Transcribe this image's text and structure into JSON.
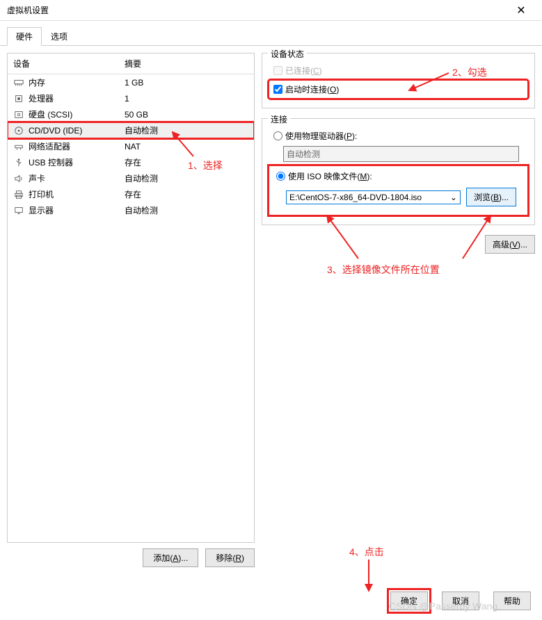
{
  "window": {
    "title": "虚拟机设置"
  },
  "tabs": {
    "hardware": "硬件",
    "options": "选项"
  },
  "deviceTable": {
    "headers": {
      "device": "设备",
      "summary": "摘要"
    },
    "rows": [
      {
        "name": "内存",
        "summary": "1 GB"
      },
      {
        "name": "处理器",
        "summary": "1"
      },
      {
        "name": "硬盘 (SCSI)",
        "summary": "50 GB"
      },
      {
        "name": "CD/DVD (IDE)",
        "summary": "自动检测"
      },
      {
        "name": "网络适配器",
        "summary": "NAT"
      },
      {
        "name": "USB 控制器",
        "summary": "存在"
      },
      {
        "name": "声卡",
        "summary": "自动检测"
      },
      {
        "name": "打印机",
        "summary": "存在"
      },
      {
        "name": "显示器",
        "summary": "自动检测"
      }
    ]
  },
  "leftButtons": {
    "add": "添加(A)...",
    "remove": "移除(R)"
  },
  "deviceStatus": {
    "legend": "设备状态",
    "connected": "已连接(C)",
    "connectAtPowerOn": "启动时连接(O)"
  },
  "connection": {
    "legend": "连接",
    "physical": "使用物理驱动器(P):",
    "physicalValue": "自动检测",
    "iso": "使用 ISO 映像文件(M):",
    "isoValue": "E:\\CentOS-7-x86_64-DVD-1804.iso",
    "browse": "浏览(B)...",
    "advanced": "高级(V)..."
  },
  "footer": {
    "ok": "确定",
    "cancel": "取消",
    "help": "帮助"
  },
  "annotations": {
    "a1": "1、选择",
    "a2": "2、勾选",
    "a3": "3、选择镜像文件所在位置",
    "a4": "4、点击"
  },
  "watermark": "CSDN @Passerby Wang."
}
